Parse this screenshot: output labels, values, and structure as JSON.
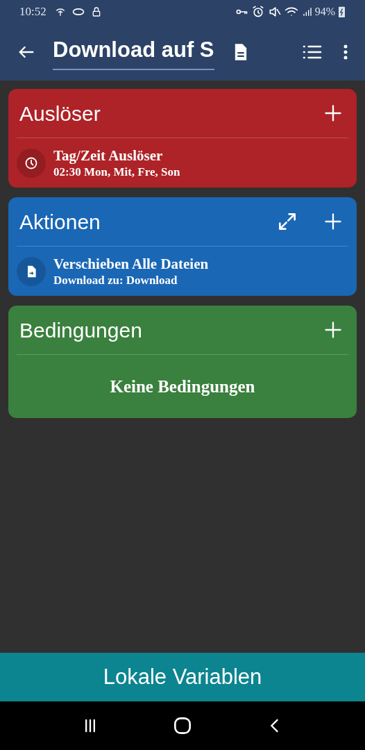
{
  "status_bar": {
    "time": "10:52",
    "battery": "94%"
  },
  "toolbar": {
    "title": "Download auf S"
  },
  "sections": [
    {
      "title": "Auslöser",
      "color": "#ad2327",
      "expandable": false,
      "entries": [
        {
          "kind": "clock",
          "title": "Tag/Zeit Auslöser",
          "subtitle": "02:30 Mon, Mit, Fre, Son"
        }
      ]
    },
    {
      "title": "Aktionen",
      "color": "#1a67b5",
      "expandable": true,
      "entries": [
        {
          "kind": "file",
          "title": "Verschieben Alle Dateien",
          "subtitle": "Download zu: Download"
        }
      ]
    },
    {
      "title": "Bedingungen",
      "color": "#3a803e",
      "expandable": false,
      "empty_text": "Keine Bedingungen"
    }
  ],
  "bottom_button": "Lokale Variablen"
}
